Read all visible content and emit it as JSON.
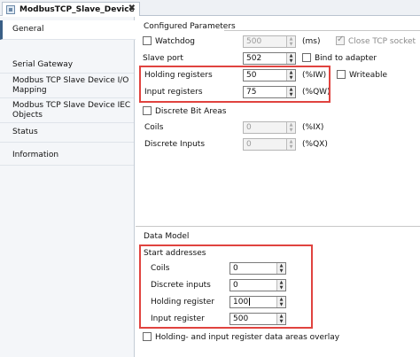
{
  "window": {
    "tab_title": "ModbusTCP_Slave_Device",
    "tab_close": "✖"
  },
  "sidebar": {
    "items": [
      {
        "label": "General",
        "active": true
      },
      {
        "label": "Serial Gateway"
      },
      {
        "label": "Modbus TCP Slave Device I/O Mapping"
      },
      {
        "label": "Modbus TCP Slave Device IEC Objects"
      },
      {
        "label": "Status"
      },
      {
        "label": "Information"
      }
    ]
  },
  "configured": {
    "title": "Configured Parameters",
    "watchdog": {
      "label": "Watchdog",
      "value": "500",
      "unit": "(ms)",
      "checked": false
    },
    "close_tcp": {
      "label": "Close TCP socket",
      "checked": true
    },
    "slave_port": {
      "label": "Slave port",
      "value": "502"
    },
    "bind_adapter": {
      "label": "Bind to adapter",
      "checked": false
    },
    "holding": {
      "label": "Holding registers",
      "value": "50",
      "unit": "(%IW)"
    },
    "writeable": {
      "label": "Writeable",
      "checked": false
    },
    "input": {
      "label": "Input registers",
      "value": "75",
      "unit": "(%QW)"
    },
    "discrete_bit": {
      "label": "Discrete Bit Areas",
      "checked": false
    },
    "coils": {
      "label": "Coils",
      "value": "0",
      "unit": "(%IX)"
    },
    "discrete_inputs": {
      "label": "Discrete Inputs",
      "value": "0",
      "unit": "(%QX)"
    }
  },
  "data_model": {
    "title": "Data Model",
    "start_addresses": "Start addresses",
    "coils": {
      "label": "Coils",
      "value": "0"
    },
    "discrete_inputs": {
      "label": "Discrete inputs",
      "value": "0"
    },
    "holding_register": {
      "label": "Holding register",
      "value": "100"
    },
    "input_register": {
      "label": "Input register",
      "value": "500"
    },
    "overlay": {
      "label": "Holding- and input register data areas overlay",
      "checked": false
    }
  },
  "colors": {
    "highlight": "#e0433f",
    "active_nav": "#3a5f86"
  }
}
